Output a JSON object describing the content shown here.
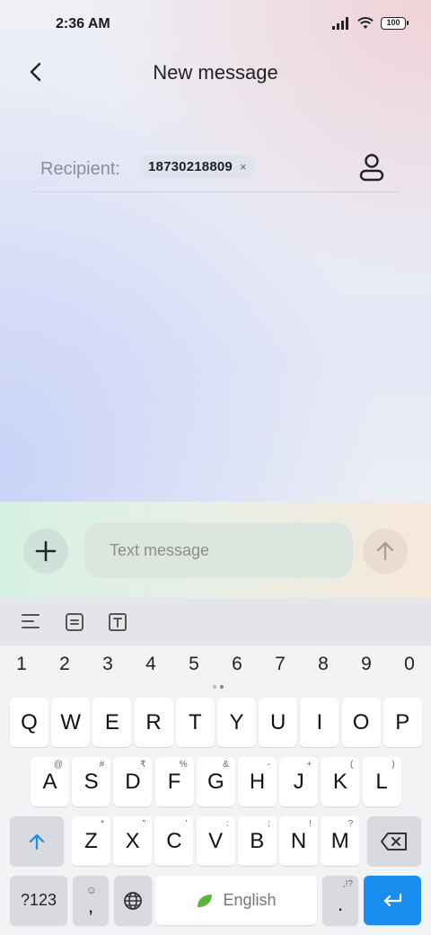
{
  "status": {
    "time": "2:36 AM",
    "battery": "100",
    "signal_icon": "signal-icon",
    "wifi_icon": "wifi-icon"
  },
  "header": {
    "title": "New message",
    "back_icon": "back-arrow-icon"
  },
  "recipient": {
    "label": "Recipient:",
    "chip_number": "18730218809",
    "chip_remove": "×",
    "contact_icon": "contact-icon"
  },
  "compose": {
    "add_icon": "plus-icon",
    "placeholder": "Text message",
    "send_icon": "send-arrow-icon"
  },
  "keyboard": {
    "toolbar_icons": [
      "align-icon",
      "clipboard-icon",
      "text-format-icon"
    ],
    "numbers": [
      "1",
      "2",
      "3",
      "4",
      "5",
      "6",
      "7",
      "8",
      "9",
      "0"
    ],
    "row1": [
      {
        "k": "Q",
        "s": ""
      },
      {
        "k": "W",
        "s": ""
      },
      {
        "k": "E",
        "s": ""
      },
      {
        "k": "R",
        "s": ""
      },
      {
        "k": "T",
        "s": ""
      },
      {
        "k": "Y",
        "s": ""
      },
      {
        "k": "U",
        "s": ""
      },
      {
        "k": "I",
        "s": ""
      },
      {
        "k": "O",
        "s": ""
      },
      {
        "k": "P",
        "s": ""
      }
    ],
    "row2": [
      {
        "k": "A",
        "s": "@"
      },
      {
        "k": "S",
        "s": "#"
      },
      {
        "k": "D",
        "s": "₹"
      },
      {
        "k": "F",
        "s": "%"
      },
      {
        "k": "G",
        "s": "&"
      },
      {
        "k": "H",
        "s": "-"
      },
      {
        "k": "J",
        "s": "+"
      },
      {
        "k": "K",
        "s": "("
      },
      {
        "k": "L",
        "s": ")"
      }
    ],
    "row3": [
      {
        "k": "Z",
        "s": "*"
      },
      {
        "k": "X",
        "s": "\""
      },
      {
        "k": "C",
        "s": "'"
      },
      {
        "k": "V",
        "s": ":"
      },
      {
        "k": "B",
        "s": ";"
      },
      {
        "k": "N",
        "s": "!"
      },
      {
        "k": "M",
        "s": "?"
      }
    ],
    "symbols_key": "?123",
    "comma_key": ",",
    "space_label": "English",
    "period_key": ".",
    "period_sup": ",!?",
    "accent_color": "#1a8df0"
  }
}
